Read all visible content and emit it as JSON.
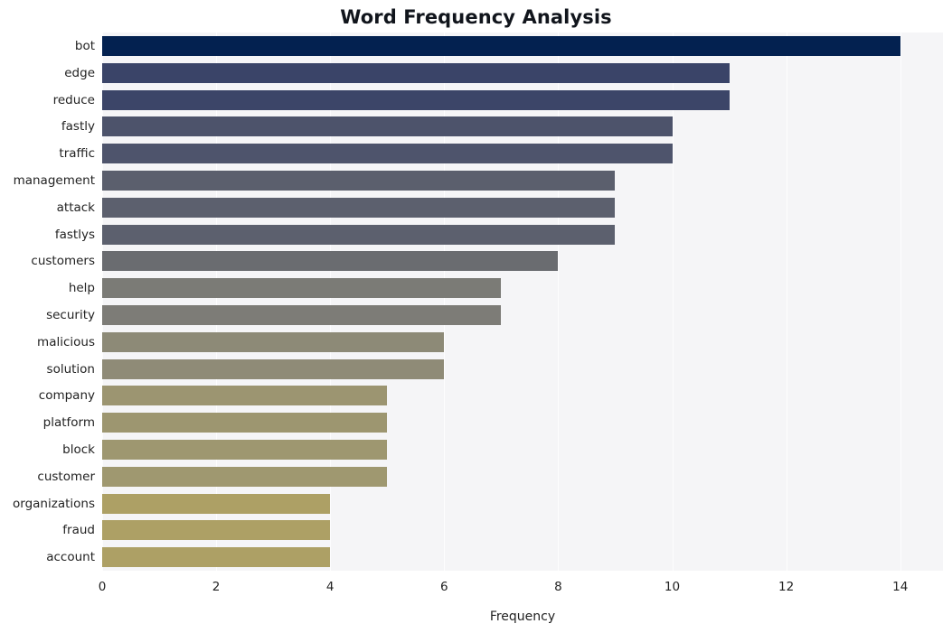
{
  "chart_data": {
    "type": "bar",
    "orientation": "horizontal",
    "title": "Word Frequency Analysis",
    "xlabel": "Frequency",
    "ylabel": "",
    "categories": [
      "bot",
      "edge",
      "reduce",
      "fastly",
      "traffic",
      "management",
      "attack",
      "fastlys",
      "customers",
      "help",
      "security",
      "malicious",
      "solution",
      "company",
      "platform",
      "block",
      "customer",
      "organizations",
      "fraud",
      "account"
    ],
    "values": [
      14,
      11,
      11,
      10,
      10,
      9,
      9,
      9,
      8,
      7,
      7,
      6,
      6,
      5,
      5,
      5,
      5,
      4,
      4,
      4
    ],
    "bar_colors": [
      "#032150",
      "#3a4468",
      "#3c4568",
      "#4d536b",
      "#4e546c",
      "#5b5f6d",
      "#5c606e",
      "#5c606e",
      "#6a6c70",
      "#7b7b76",
      "#7d7c77",
      "#8d8a77",
      "#8f8b77",
      "#9c9571",
      "#9d9670",
      "#9e9770",
      "#9f9870",
      "#ada065",
      "#ada065",
      "#ada065"
    ],
    "xlim": [
      0,
      14.75
    ],
    "xticks": [
      0,
      2,
      4,
      6,
      8,
      10,
      12,
      14
    ],
    "xticklabels": [
      "0",
      "2",
      "4",
      "6",
      "8",
      "10",
      "12",
      "14"
    ],
    "grid": true,
    "grid_axis": "x",
    "legend": "none",
    "plot_background": "#f5f5f7",
    "figure_background": "#ffffff",
    "gridline_color": "#fdfdfe",
    "text_color": "#222222",
    "title_color": "#11151c"
  }
}
